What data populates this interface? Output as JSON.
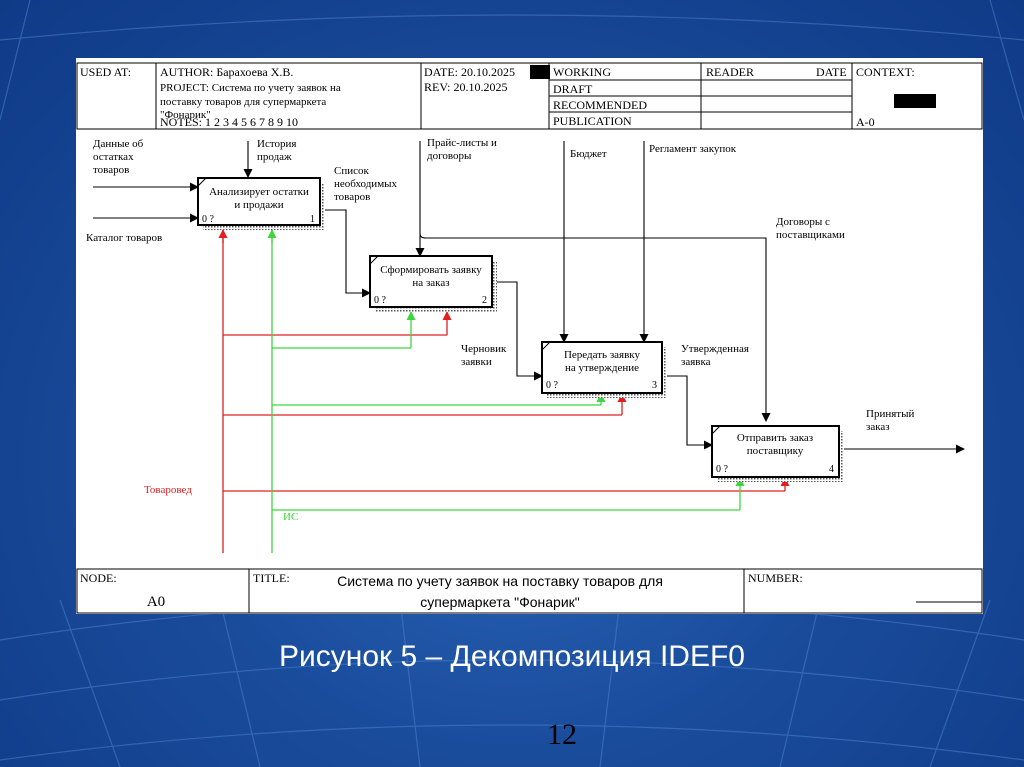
{
  "header": {
    "used_at": "USED AT:",
    "author": "AUTHOR: Барахоева Х.В.",
    "project_line1": "PROJECT: Система по учету заявок на",
    "project_line2": "поставку товаров для супермаркета",
    "project_line3": "\"Фонарик\"",
    "notes": "NOTES: 1 2 3 4 5 6 7 8 9 10",
    "date": "DATE: 20.10.2025",
    "rev": "REV: 20.10.2025",
    "status_working": "WORKING",
    "status_draft": "DRAFT",
    "status_recommended": "RECOMMENDED",
    "status_publication": "PUBLICATION",
    "reader": "READER",
    "reader_date": "DATE",
    "context": "CONTEXT:",
    "context_node": "A-0"
  },
  "boxes": [
    {
      "label1": "Анализирует остатки",
      "label2": "и продажи",
      "cost": "0 ?",
      "num": "1"
    },
    {
      "label1": "Сформировать заявку",
      "label2": "на заказ",
      "cost": "0 ?",
      "num": "2"
    },
    {
      "label1": "Передать заявку",
      "label2": "на утверждение",
      "cost": "0 ?",
      "num": "3"
    },
    {
      "label1": "Отправить заказ",
      "label2": "поставщику",
      "cost": "0 ?",
      "num": "4"
    }
  ],
  "arrows": {
    "data_remains_1": "Данные об",
    "data_remains_2": "остатках",
    "data_remains_3": "товаров",
    "catalog": "Каталог товаров",
    "sales_history_1": "История",
    "sales_history_2": "продаж",
    "needed_list_1": "Список",
    "needed_list_2": "необходимых",
    "needed_list_3": "товаров",
    "price_lists_1": "Прайс-листы и",
    "price_lists_2": "договоры",
    "budget": "Бюджет",
    "procurement_rules": "Регламент закупок",
    "supplier_contracts_1": "Договоры с",
    "supplier_contracts_2": "поставщиками",
    "draft_requests_1": "Черновик",
    "draft_requests_2": "заявки",
    "approved_request_1": "Утвержденная",
    "approved_request_2": "заявка",
    "accepted_order_1": "Принятый",
    "accepted_order_2": "заказ",
    "merchandiser": "Товаровед",
    "is": "ИС"
  },
  "footer": {
    "node_label": "NODE:",
    "node_value": "A0",
    "title_label": "TITLE:",
    "title_line1": "Система по учету заявок на поставку  товаров для",
    "title_line2": "супермаркета \"Фонарик\"",
    "number_label": "NUMBER:"
  },
  "caption": "Рисунок 5 – Декомпозиция IDEF0",
  "page_number": "12",
  "colors": {
    "mechanism_red": "#e02020",
    "mechanism_green": "#3ed63e",
    "background": "#1a4c9c"
  }
}
